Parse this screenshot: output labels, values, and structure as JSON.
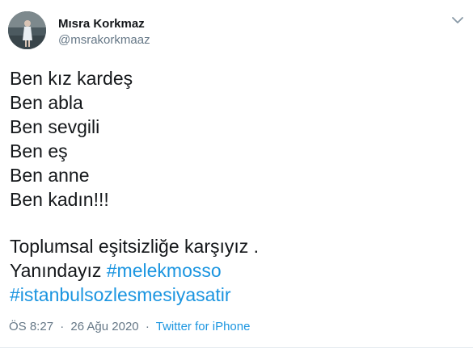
{
  "user": {
    "name": "Mısra Korkmaz",
    "handle": "@msrakorkmaaz"
  },
  "tweet": {
    "lines": [
      "Ben kız kardeş",
      "Ben abla",
      "Ben sevgili",
      "Ben eş",
      "Ben anne",
      "Ben kadın!!!"
    ],
    "line_after_break": "Toplumsal eşitsizliğe karşıyız .",
    "last_line_text": "Yanındayız ",
    "hashtag_1": "#melekmosso",
    "hashtag_2": "#istanbulsozlesmesiyasatir"
  },
  "meta": {
    "time": "ÖS 8:27",
    "separator": "·",
    "date": "26 Ağu 2020",
    "source": "Twitter for iPhone"
  },
  "icons": {
    "more": "chevron-down-icon"
  },
  "colors": {
    "text": "#14171a",
    "secondary": "#657786",
    "link": "#1b95e0"
  }
}
